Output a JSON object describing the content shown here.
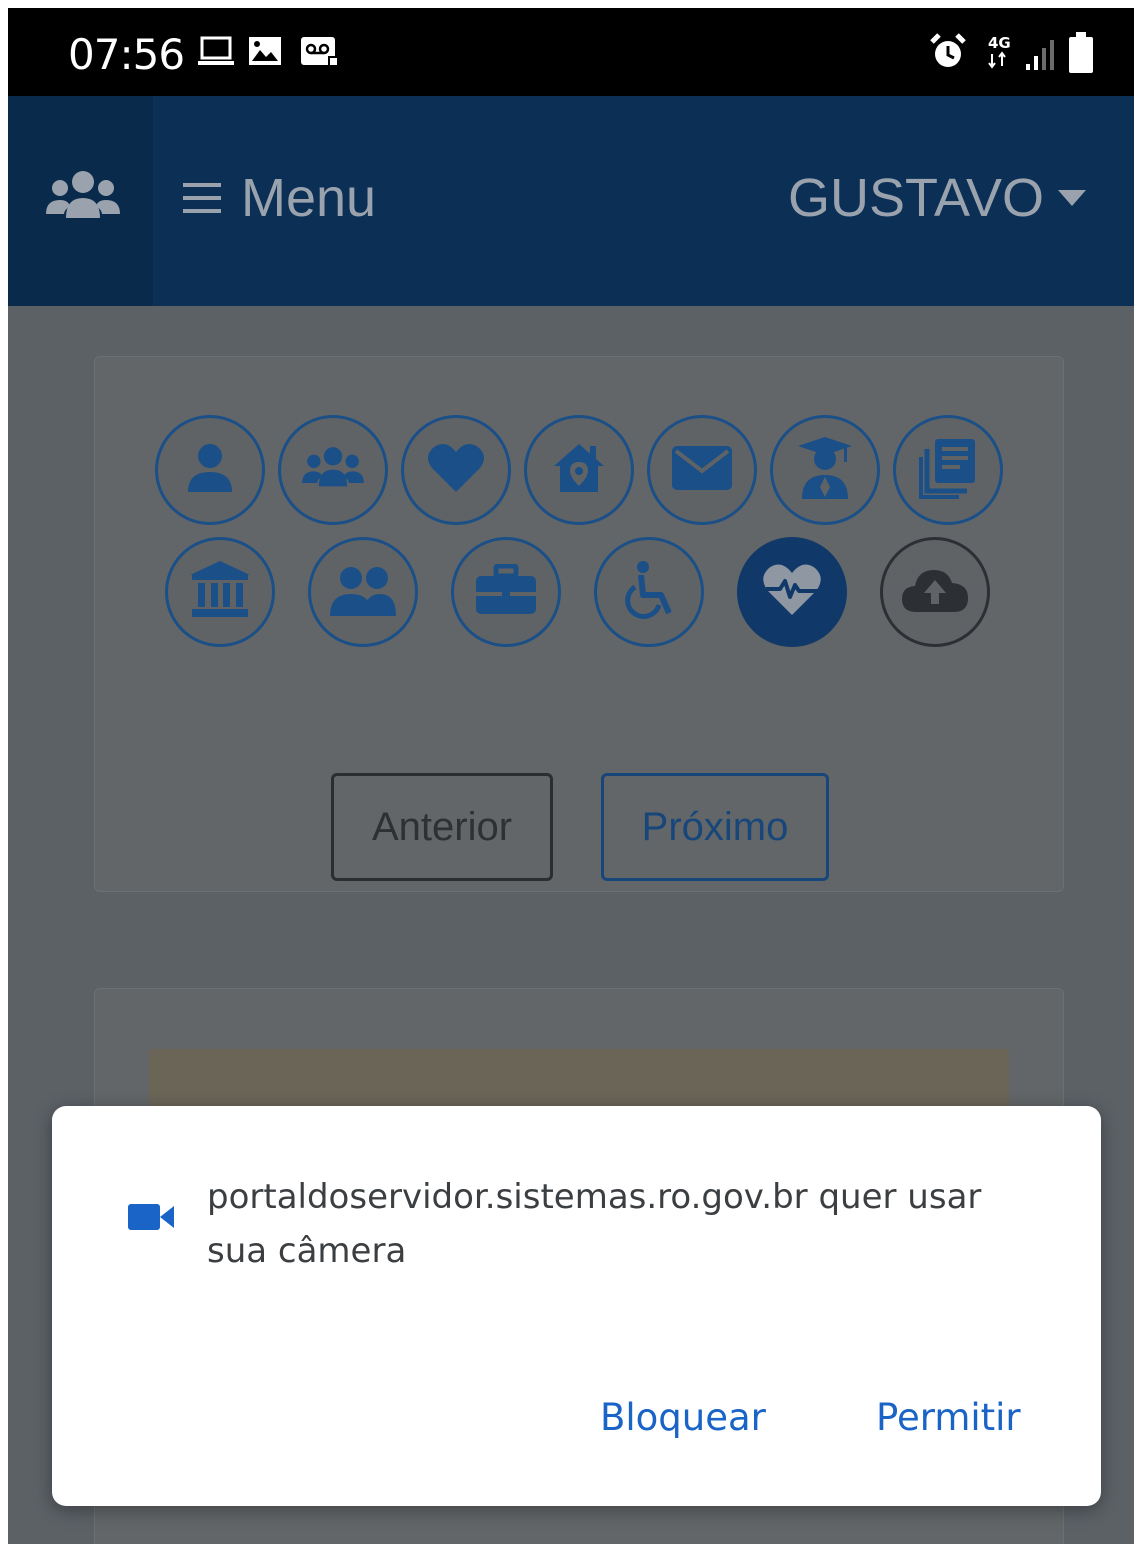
{
  "status_bar": {
    "time": "07:56",
    "icons": [
      "laptop-icon",
      "image-icon",
      "voicemail-icon",
      "alarm-icon",
      "network-4g-icon",
      "signal-icon",
      "battery-icon"
    ],
    "network": "4G"
  },
  "header": {
    "menu_label": "Menu",
    "user_name": "GUSTAVO",
    "icons": [
      "team-icon",
      "hamburger-icon",
      "caret-down-icon"
    ]
  },
  "wizard": {
    "steps": [
      {
        "icon": "user-icon"
      },
      {
        "icon": "users-group-icon"
      },
      {
        "icon": "heart-icon"
      },
      {
        "icon": "home-location-icon"
      },
      {
        "icon": "envelope-icon"
      },
      {
        "icon": "graduate-icon"
      },
      {
        "icon": "documents-icon"
      },
      {
        "icon": "institution-icon"
      },
      {
        "icon": "users-pair-icon"
      },
      {
        "icon": "briefcase-icon"
      },
      {
        "icon": "wheelchair-icon"
      },
      {
        "icon": "heartbeat-icon",
        "active": true
      },
      {
        "icon": "cloud-upload-icon"
      }
    ],
    "prev_label": "Anterior",
    "next_label": "Próximo"
  },
  "permission_dialog": {
    "message": "portaldoservidor.sistemas.ro.gov.br quer usar sua câmera",
    "icon": "camera-icon",
    "block_label": "Bloquear",
    "allow_label": "Permitir"
  },
  "colors": {
    "header_bg": "#0b2f55",
    "primary_blue": "#1a4f87",
    "dialog_button": "#1a63c7",
    "overlay": "#5c6166"
  }
}
